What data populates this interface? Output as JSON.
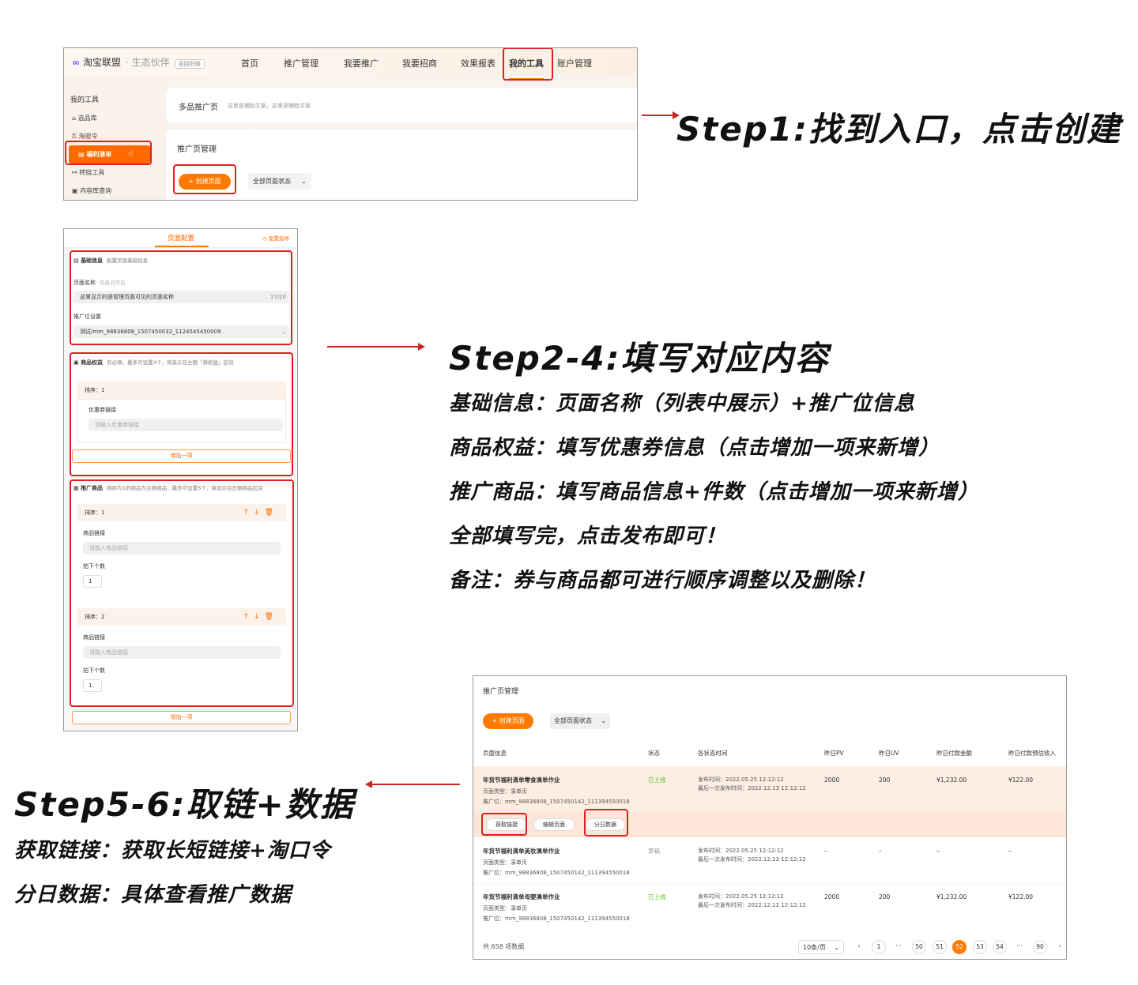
{
  "step1": {
    "title": "Step1:找到入口，点击创建",
    "logo": "淘宝联盟",
    "logo_sub": "· 生态伙伴",
    "old_link": "返回旧版",
    "nav": [
      "首页",
      "推广管理",
      "我要推广",
      "我要招商",
      "效果报表",
      "我的工具",
      "账户管理"
    ],
    "sidebar_head": "我的工具",
    "sidebar": [
      "选品库",
      "淘密令",
      "福利清单",
      "转链工具",
      "内容库查询"
    ],
    "card_title": "多品推广页",
    "card_hint": "这里是辅助文案，这里是辅助文案",
    "manage_title": "推广页管理",
    "create_btn": "+ 创建页面",
    "status_select": "全部页面状态"
  },
  "step2": {
    "title": "Step2-4:填写对应内容",
    "lines": [
      "基础信息：页面名称（列表中展示）+推广位信息",
      "商品权益：填写优惠券信息（点击增加一项来新增）",
      "推广商品：填写商品信息+件数（点击增加一项来新增）",
      "全部填写完，点击发布即可！",
      "备注：券与商品都可进行顺序调整以及删除！"
    ],
    "tab": "页面配置",
    "guide": "配置指导",
    "basic": {
      "title": "基础信息",
      "hint": "配置页面基础信息",
      "name_label": "页面名称",
      "name_hint": "仅自己可见",
      "name_value": "这里显示的是管理页面可见的页面名称",
      "name_count": "17/20",
      "pos_label": "推广位设置",
      "pos_value": "测试/mm_98836808_1507450032_1124545450009"
    },
    "rights": {
      "title": "商品权益",
      "hint": "非必填，最多可设置3个，将显示在左侧「券权益」区块",
      "sort": "排序：1",
      "coupon_label": "优惠券链接",
      "coupon_placeholder": "请输入优惠券链接",
      "add": "增加一项"
    },
    "goods": {
      "title": "推广商品",
      "hint": "排序为1的商品为主推商品，最多可设置5个，将显示在左侧商品区块",
      "items": [
        {
          "sort": "排序：1",
          "link_label": "商品链接",
          "link_placeholder": "请输入商品链接",
          "count_label": "拍下个数",
          "count": "1"
        },
        {
          "sort": "排序：2",
          "link_label": "商品链接",
          "link_placeholder": "请输入商品链接",
          "count_label": "拍下个数",
          "count": "1"
        }
      ],
      "add": "增加一项"
    }
  },
  "step5": {
    "title": "Step5-6:取链+数据",
    "lines": [
      "获取链接：获取长短链接+淘口令",
      "分日数据：具体查看推广数据"
    ],
    "manage_title": "推广页管理",
    "create_btn": "+ 创建页面",
    "status_select": "全部页面状态",
    "headers": [
      "页面信息",
      "状态",
      "各状态时间",
      "昨日PV",
      "昨日UV",
      "昨日付款金额",
      "昨日付款预估收入"
    ],
    "rows": [
      {
        "name": "年货节福利清单零食凑单作业",
        "type": "页面类型：凑单页",
        "pos": "推广位：mm_98836808_1507450142_111394550018",
        "status": "已上线",
        "pub": "发布时间：2022.05.25 12:12:12",
        "last": "最后一次发布时间：2022.12.13 12:12:12",
        "pv": "2000",
        "uv": "200",
        "pay": "¥1,232.00",
        "income": "¥122.00"
      },
      {
        "name": "年货节福利清单美妆凑单作业",
        "type": "页面类型：凑单页",
        "pos": "推广位：mm_98836808_1507450142_111394550018",
        "status": "草稿",
        "pub": "发布时间：2022.05.25 12:12:12",
        "last": "最后一次发布时间：2022.12.12 12:12:12",
        "pv": "–",
        "uv": "–",
        "pay": "–",
        "income": "–"
      },
      {
        "name": "年货节福利清单母婴凑单作业",
        "type": "页面类型：凑单页",
        "pos": "推广位：mm_98836808_1507450142_111394550018",
        "status": "已上线",
        "pub": "发布时间：2022.05.25 12:12:12",
        "last": "最后一次发布时间：2022.12.12 12:12:12",
        "pv": "2000",
        "uv": "200",
        "pay": "¥1,232.00",
        "income": "¥122.00"
      }
    ],
    "actions": [
      "获取链接",
      "编辑页面",
      "分日数据"
    ],
    "total": "共 658 项数据",
    "page_size": "10条/页",
    "pages": [
      "1",
      "···",
      "50",
      "51",
      "52",
      "53",
      "54",
      "···",
      "90"
    ],
    "current_page": "52",
    "accent": "#ff7a00",
    "online_color": "#52c41a"
  }
}
